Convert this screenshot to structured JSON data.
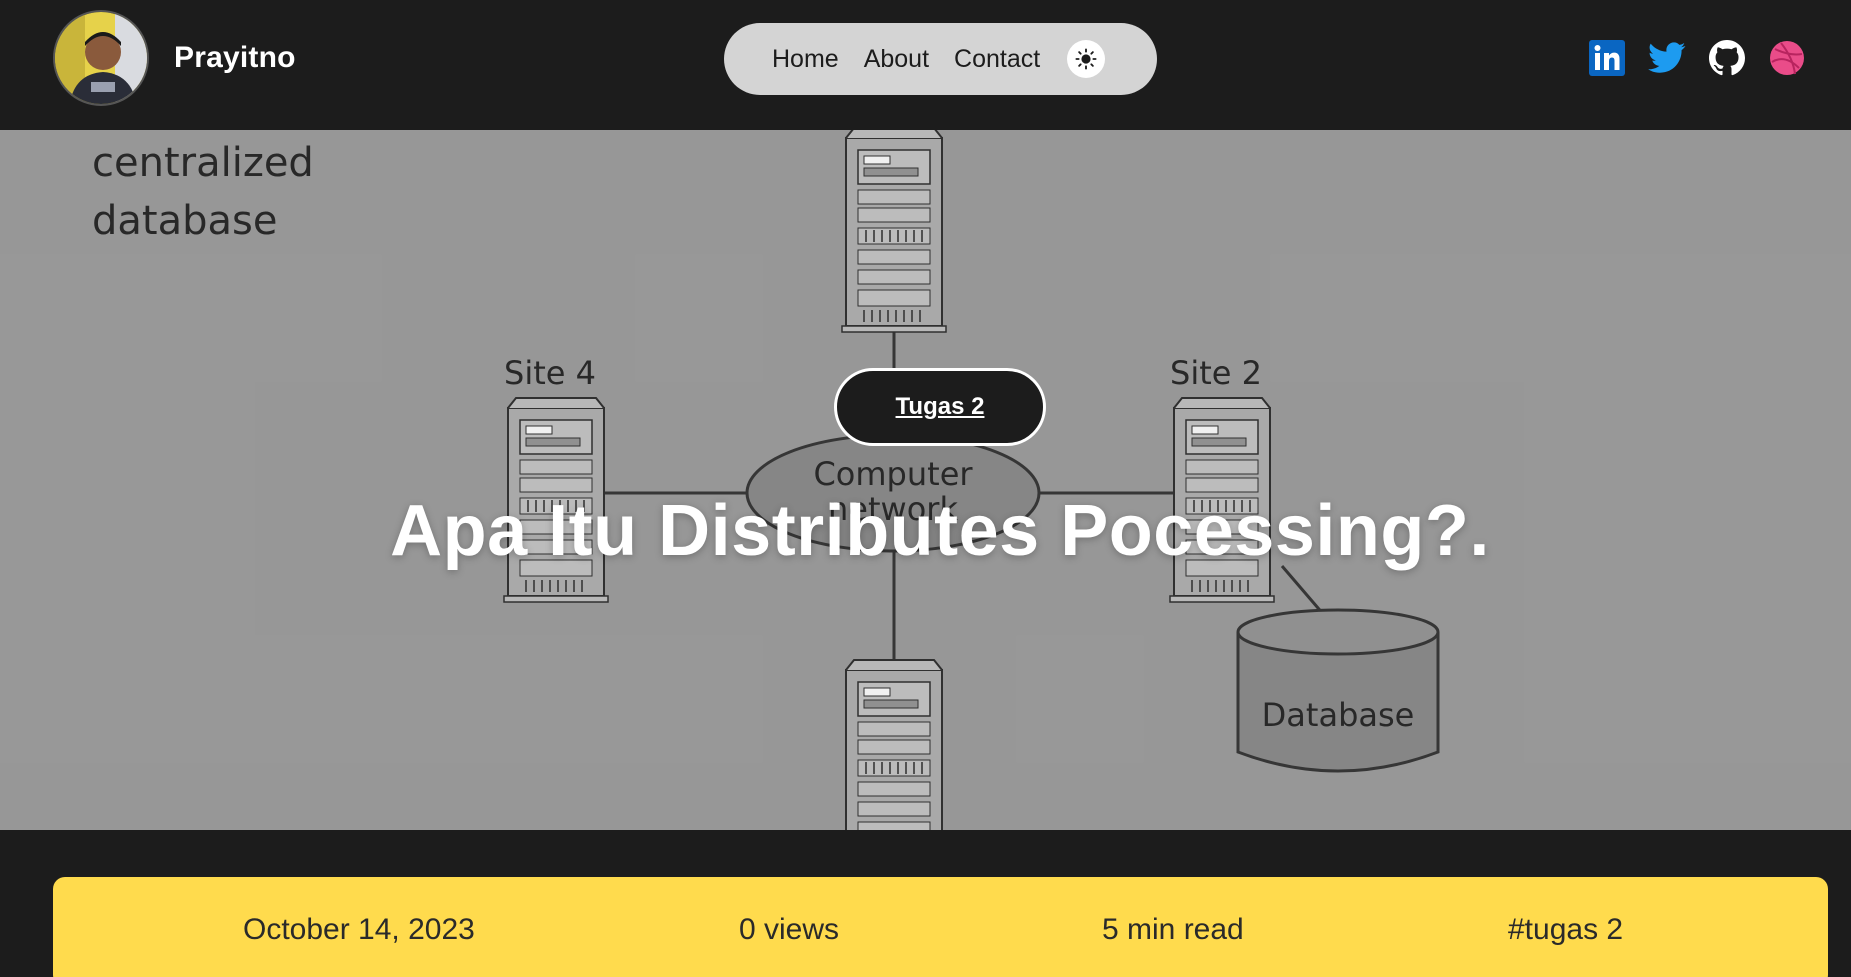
{
  "header": {
    "brand_name": "Prayitno",
    "nav": {
      "home": "Home",
      "about": "About",
      "contact": "Contact"
    },
    "theme_icon": "sun-icon",
    "socials": [
      {
        "name": "linkedin-icon",
        "color": "#0a66c2"
      },
      {
        "name": "twitter-icon",
        "color": "#1d9bf0"
      },
      {
        "name": "github-icon",
        "color": "#ffffff"
      },
      {
        "name": "dribbble-icon",
        "color": "#ea4c89"
      }
    ]
  },
  "hero": {
    "image_labels": {
      "centralized_line1": "centralized",
      "centralized_line2": "database",
      "site4": "Site 4",
      "site2": "Site 2",
      "network_line1": "Computer",
      "network_line2": "network",
      "database": "Database"
    },
    "category": "Tugas 2",
    "title": "Apa Itu Distributes Pocessing?."
  },
  "meta": {
    "date": "October 14, 2023",
    "views": "0 views",
    "read_time": "5 min read",
    "tag": "#tugas 2"
  },
  "colors": {
    "background": "#1c1c1c",
    "nav_pill": "#d4d4d4",
    "meta_bar": "#ffdb4d",
    "hero_bg": "#a1a1a1"
  }
}
